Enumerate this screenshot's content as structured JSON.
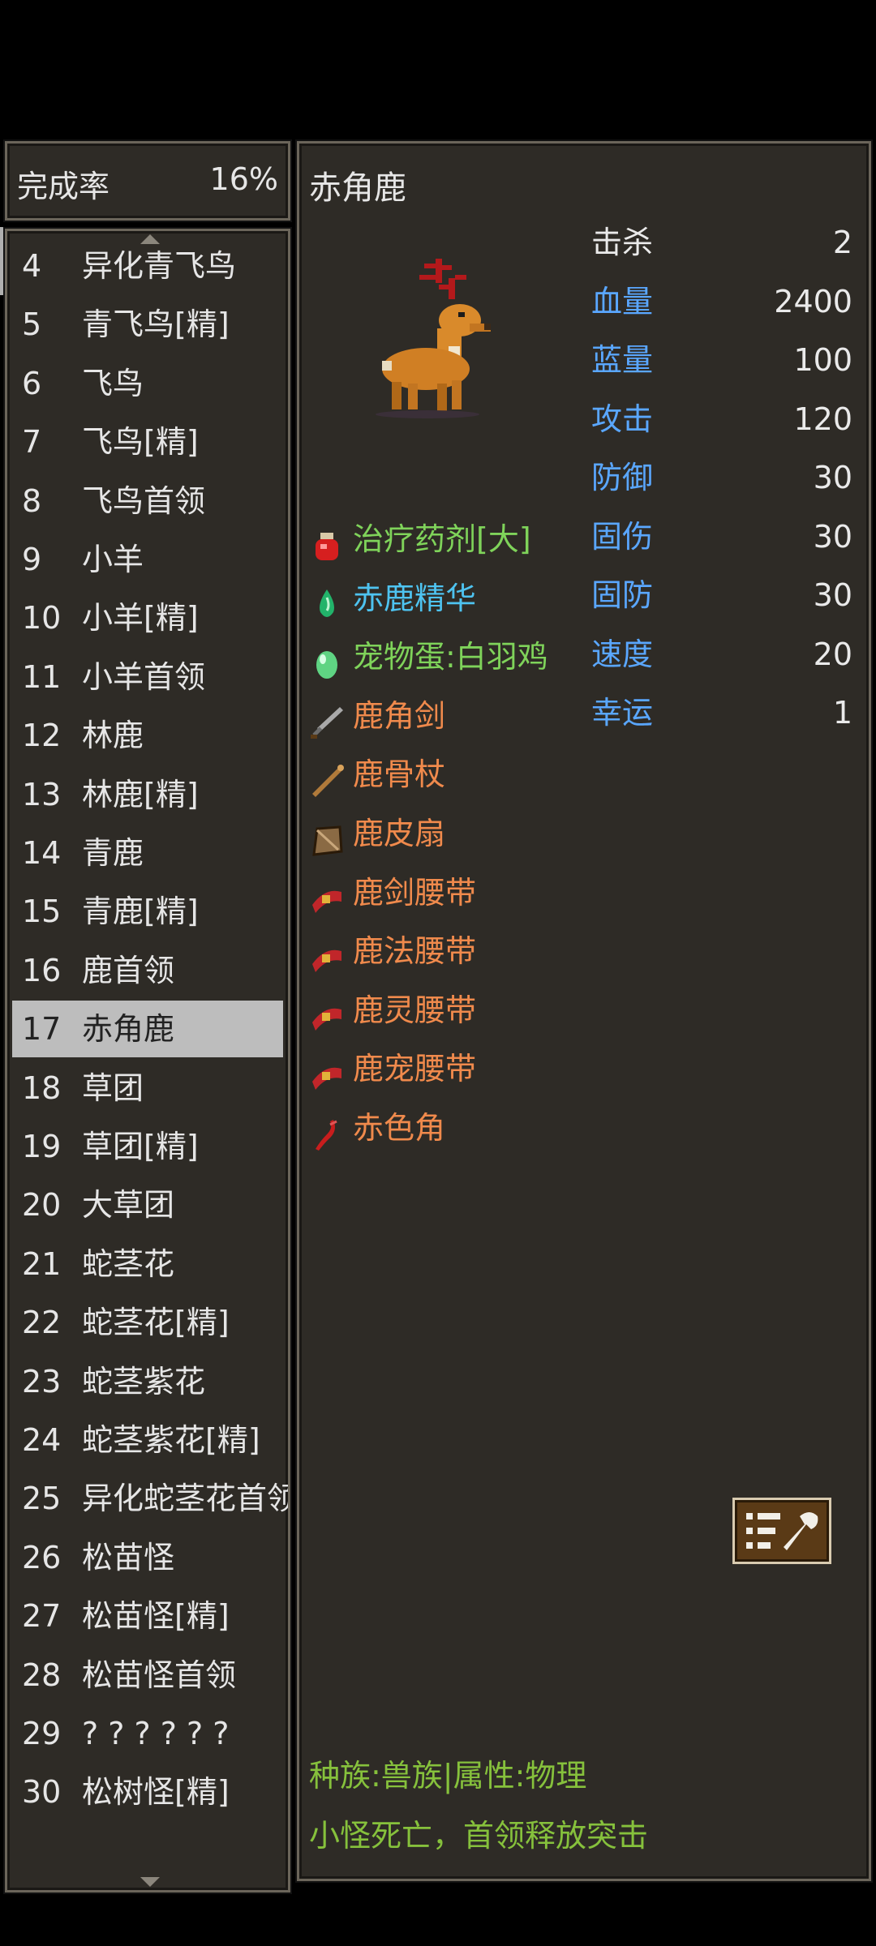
{
  "completion": {
    "label": "完成率",
    "value": "16%"
  },
  "list": {
    "items": [
      {
        "num": "4",
        "name": "异化青飞鸟"
      },
      {
        "num": "5",
        "name": "青飞鸟[精]"
      },
      {
        "num": "6",
        "name": "飞鸟"
      },
      {
        "num": "7",
        "name": "飞鸟[精]"
      },
      {
        "num": "8",
        "name": "飞鸟首领"
      },
      {
        "num": "9",
        "name": "小羊"
      },
      {
        "num": "10",
        "name": "小羊[精]"
      },
      {
        "num": "11",
        "name": "小羊首领"
      },
      {
        "num": "12",
        "name": "林鹿"
      },
      {
        "num": "13",
        "name": "林鹿[精]"
      },
      {
        "num": "14",
        "name": "青鹿"
      },
      {
        "num": "15",
        "name": "青鹿[精]"
      },
      {
        "num": "16",
        "name": "鹿首领"
      },
      {
        "num": "17",
        "name": "赤角鹿"
      },
      {
        "num": "18",
        "name": "草团"
      },
      {
        "num": "19",
        "name": "草团[精]"
      },
      {
        "num": "20",
        "name": "大草团"
      },
      {
        "num": "21",
        "name": "蛇茎花"
      },
      {
        "num": "22",
        "name": "蛇茎花[精]"
      },
      {
        "num": "23",
        "name": "蛇茎紫花"
      },
      {
        "num": "24",
        "name": "蛇茎紫花[精]"
      },
      {
        "num": "25",
        "name": "异化蛇茎花首领"
      },
      {
        "num": "26",
        "name": "松苗怪"
      },
      {
        "num": "27",
        "name": "松苗怪[精]"
      },
      {
        "num": "28",
        "name": "松苗怪首领"
      },
      {
        "num": "29",
        "name": "? ? ? ? ? ?"
      },
      {
        "num": "30",
        "name": "松树怪[精]"
      }
    ],
    "selected": "17"
  },
  "detail": {
    "title": "赤角鹿",
    "stats": [
      {
        "key": "击杀",
        "value": "2",
        "color": "#eaeaea"
      },
      {
        "key": "血量",
        "value": "2400",
        "color": "#5aa7ff"
      },
      {
        "key": "蓝量",
        "value": "100",
        "color": "#5aa7ff"
      },
      {
        "key": "攻击",
        "value": "120",
        "color": "#5aa7ff"
      },
      {
        "key": "防御",
        "value": "30",
        "color": "#5aa7ff"
      },
      {
        "key": "固伤",
        "value": "30",
        "color": "#5aa7ff"
      },
      {
        "key": "固防",
        "value": "30",
        "color": "#5aa7ff"
      },
      {
        "key": "速度",
        "value": "20",
        "color": "#5aa7ff"
      },
      {
        "key": "幸运",
        "value": "1",
        "color": "#5aa7ff"
      }
    ],
    "drops": [
      {
        "name": "治疗药剂[大]",
        "color": "#7fd35a",
        "icon": "potion-icon"
      },
      {
        "name": "赤鹿精华",
        "color": "#4ec3f0",
        "icon": "essence-icon"
      },
      {
        "name": "宠物蛋:白羽鸡",
        "color": "#7fd35a",
        "icon": "egg-icon"
      },
      {
        "name": "鹿角剑",
        "color": "#f08a4c",
        "icon": "sword-icon"
      },
      {
        "name": "鹿骨杖",
        "color": "#f08a4c",
        "icon": "staff-icon"
      },
      {
        "name": "鹿皮扇",
        "color": "#f08a4c",
        "icon": "fan-icon"
      },
      {
        "name": "鹿剑腰带",
        "color": "#f08a4c",
        "icon": "belt-icon"
      },
      {
        "name": "鹿法腰带",
        "color": "#f08a4c",
        "icon": "belt-icon"
      },
      {
        "name": "鹿灵腰带",
        "color": "#f08a4c",
        "icon": "belt-icon"
      },
      {
        "name": "鹿宠腰带",
        "color": "#f08a4c",
        "icon": "belt-icon"
      },
      {
        "name": "赤色角",
        "color": "#f08a4c",
        "icon": "horn-icon"
      }
    ],
    "race_line": "种族:兽族|属性:物理",
    "desc_line": "小怪死亡，首领释放突击"
  }
}
